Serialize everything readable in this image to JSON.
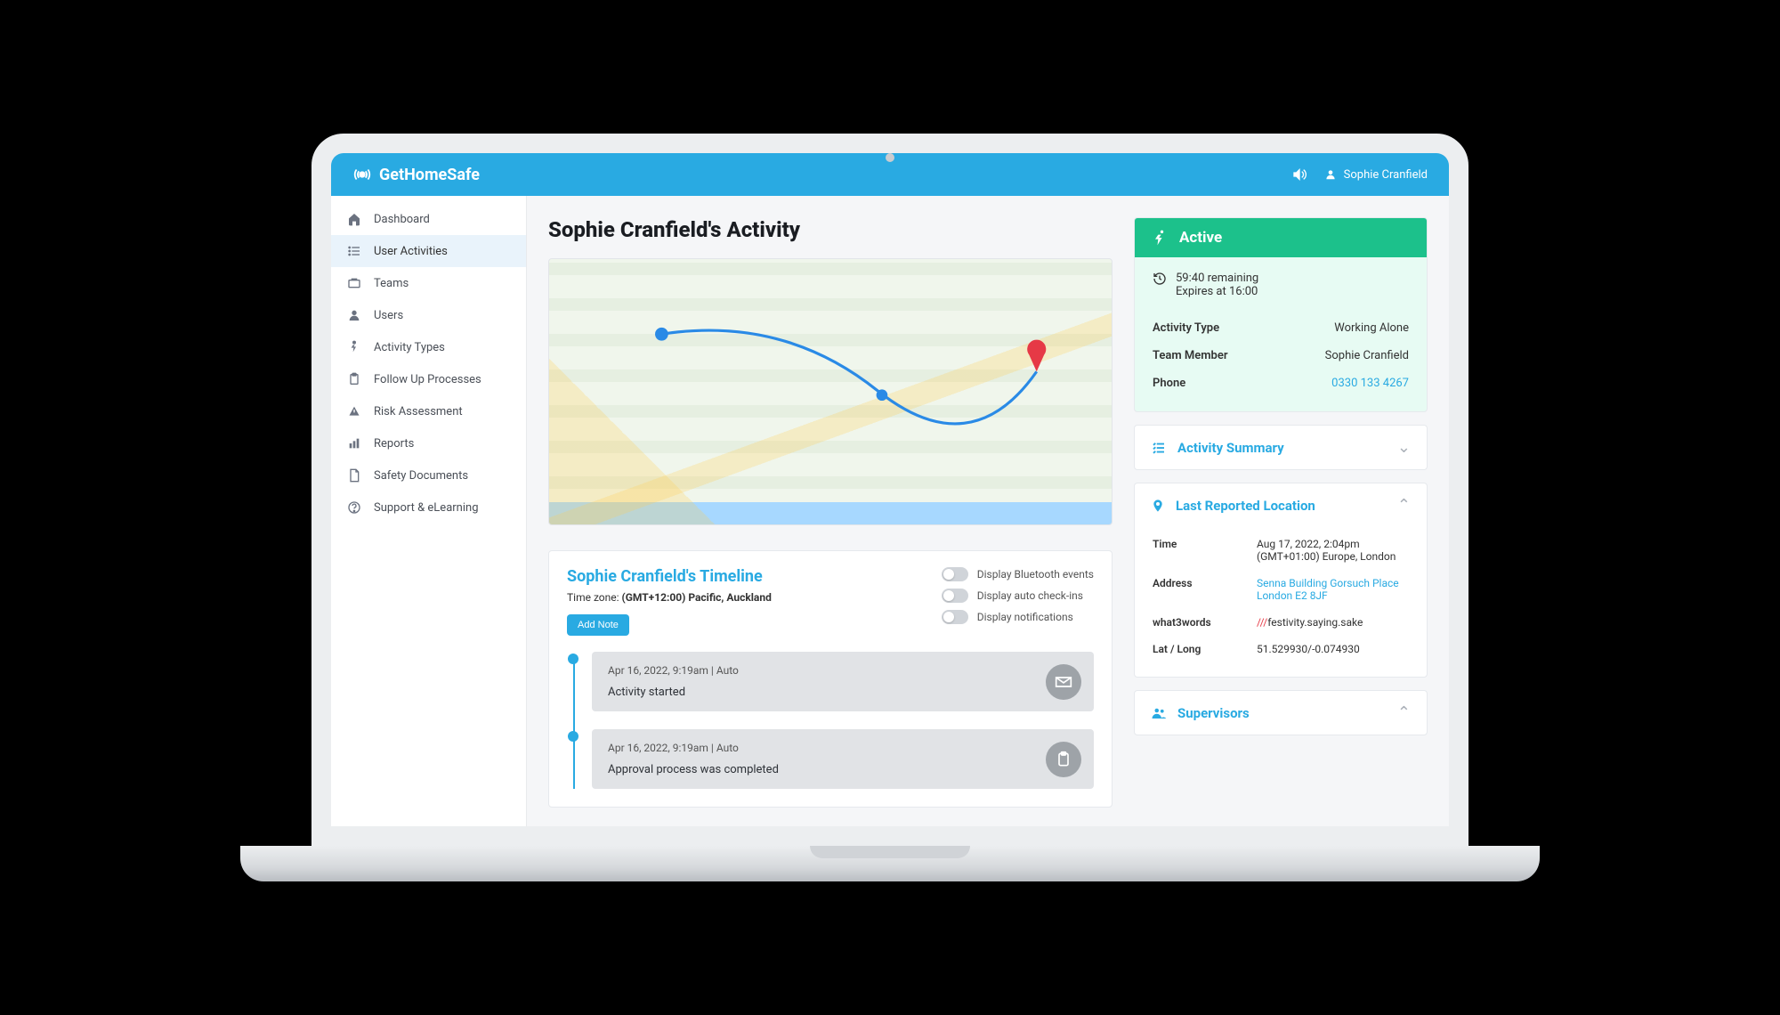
{
  "brand": "GetHomeSafe",
  "user_name": "Sophie Cranfield",
  "sidebar": {
    "items": [
      {
        "label": "Dashboard"
      },
      {
        "label": "User Activities"
      },
      {
        "label": "Teams"
      },
      {
        "label": "Users"
      },
      {
        "label": "Activity Types"
      },
      {
        "label": "Follow Up Processes"
      },
      {
        "label": "Risk Assessment"
      },
      {
        "label": "Reports"
      },
      {
        "label": "Safety Documents"
      },
      {
        "label": "Support & eLearning"
      }
    ]
  },
  "page_title": "Sophie Cranfield's Activity",
  "timeline": {
    "title": "Sophie Cranfield's Timeline",
    "tz_label": "Time zone: ",
    "tz_value": "(GMT+12:00) Pacific, Auckland",
    "add_note": "Add Note",
    "toggles": {
      "bluetooth": "Display Bluetooth events",
      "checkins": "Display auto check-ins",
      "notifications": "Display notifications"
    },
    "items": [
      {
        "meta": "Apr 16, 2022, 9:19am  |  Auto",
        "text": "Activity started",
        "icon": "mail"
      },
      {
        "meta": "Apr 16, 2022, 9:19am  |  Auto",
        "text": "Approval process was completed",
        "icon": "clipboard"
      }
    ]
  },
  "status": {
    "label": "Active",
    "remaining": "59:40 remaining",
    "expires": "Expires at 16:00",
    "rows": {
      "activity_type_key": "Activity Type",
      "activity_type_val": "Working Alone",
      "team_member_key": "Team Member",
      "team_member_val": "Sophie Cranfield",
      "phone_key": "Phone",
      "phone_val": "0330 133 4267"
    }
  },
  "panels": {
    "summary": "Activity Summary",
    "location": {
      "title": "Last Reported Location",
      "time_key": "Time",
      "time_val_1": "Aug 17, 2022, 2:04pm",
      "time_val_2": "(GMT+01:00) Europe, London",
      "address_key": "Address",
      "address_val_1": "Senna Building Gorsuch Place",
      "address_val_2": "London E2 8JF",
      "w3w_key": "what3words",
      "w3w_slashes": "///",
      "w3w_val": "festivity.saying.sake",
      "latlong_key": "Lat / Long",
      "latlong_val": "51.529930/-0.074930"
    },
    "supervisors": "Supervisors"
  }
}
